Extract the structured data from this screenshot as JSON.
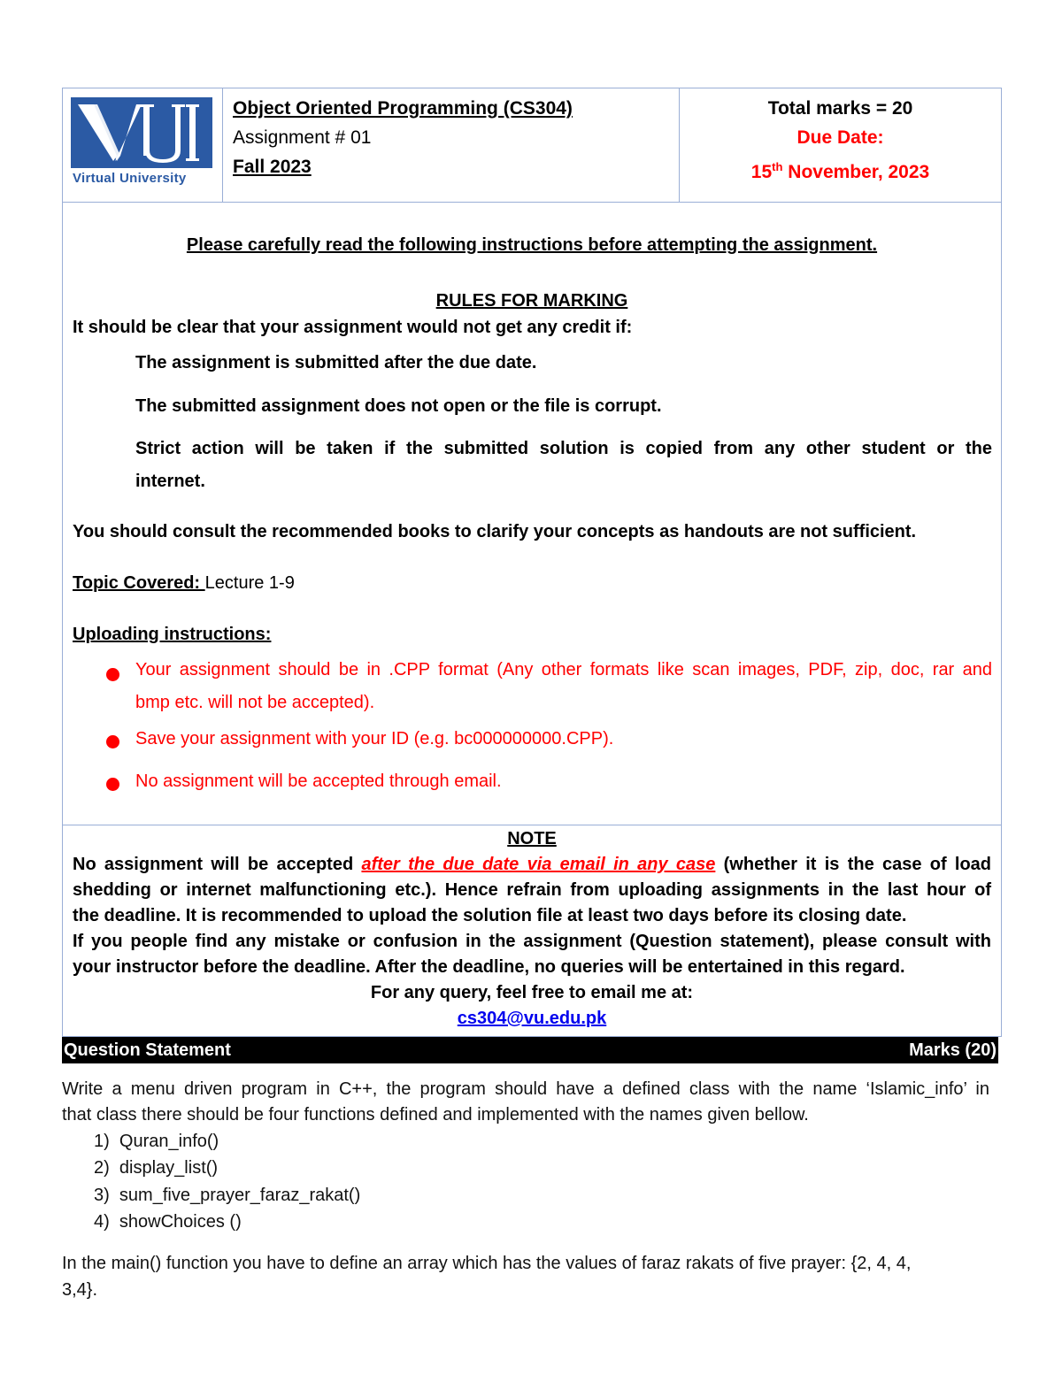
{
  "header": {
    "logo": {
      "letters": "VU",
      "caption": "Virtual University",
      "brand_color": "#2b5aa4"
    },
    "course_title": "Object Oriented Programming (CS304)",
    "assignment_label": "Assignment # 01",
    "semester": "Fall 2023",
    "total_marks": "Total marks = 20",
    "due_date_label": "Due Date:",
    "due_date_day": "15",
    "due_date_suffix": "th",
    "due_date_rest": " November, 2023"
  },
  "instructions": {
    "intro": "Please carefully read the following instructions before attempting the assignment.",
    "rules_heading": "RULES FOR MARKING",
    "rules_lead": "It should be clear that your assignment would not get any credit if:",
    "rules": [
      "The assignment is submitted after the due date.",
      "The submitted assignment does not open or the file is corrupt.",
      "Strict action will be taken if the submitted solution is copied from any other student or the",
      "internet."
    ],
    "consult": "You should consult the recommended books to clarify your concepts as handouts are not sufficient.",
    "topic_label": "Topic Covered: ",
    "topic_value": "Lecture 1-9",
    "uploading_heading": "Uploading instructions:",
    "uploading_items": [
      "Your assignment should be in .CPP format (Any other formats like scan images, PDF, zip, doc, rar and",
      "bmp etc. will not be accepted).",
      "Save your assignment with your ID (e.g. bc000000000.CPP).",
      "No assignment will be accepted through email."
    ],
    "accent_color": "#ff0000"
  },
  "note": {
    "heading": "NOTE",
    "line1_pre": "No assignment will be accepted ",
    "line1_emph": "after the due date via email in any case",
    "line1_post": " (whether it is the case of load",
    "line2": "shedding or internet malfunctioning etc.). Hence refrain from uploading assignments in the last hour of",
    "line3": "the deadline. It is recommended to upload the solution file at least two days before its closing date.",
    "line4": "If you people find any mistake or confusion in the assignment (Question statement), please consult with",
    "line5": "your instructor before the deadline. After the deadline, no queries will be entertained in this regard.",
    "query_line": "For any query, feel free to email me at:",
    "email": "cs304@vu.edu.pk"
  },
  "question": {
    "bar_left": "Question Statement",
    "bar_right": "Marks (20)",
    "para1_line1": "Write a menu driven program in C++, the program should have a defined class with the name ‘Islamic_info’ in",
    "para1_line2": "that class there should be four functions defined and implemented with the names given bellow.",
    "functions": [
      {
        "num": "1)",
        "name": "Quran_info()"
      },
      {
        "num": "2)",
        "name": "display_list()"
      },
      {
        "num": "3)",
        "name": "sum_five_prayer_faraz_rakat()"
      },
      {
        "num": "4)",
        "name": "showChoices ()"
      }
    ],
    "para2_line1": "In the main() function you have to define an array which has the values of faraz rakats of five prayer: {2, 4, 4,",
    "para2_line2": "3,4}."
  }
}
